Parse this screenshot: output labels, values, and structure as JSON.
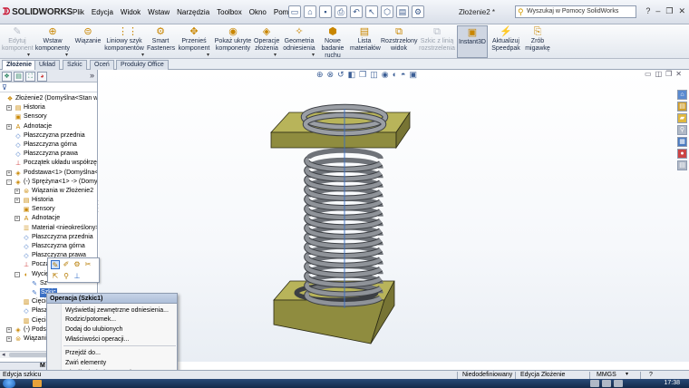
{
  "app": {
    "logo": "SOLIDWORKS",
    "document_title": "Złożenie2 *"
  },
  "menu": {
    "items": [
      "Plik",
      "Edycja",
      "Widok",
      "Wstaw",
      "Narzędzia",
      "Toolbox",
      "Okno",
      "Pomoc"
    ]
  },
  "help_search": {
    "placeholder": "Wyszukaj w Pomocy SolidWorks"
  },
  "command_manager": [
    {
      "label": "Edytuj\nkomponent",
      "icon": "edit-component-icon",
      "state": "disabled"
    },
    {
      "label": "Wstaw\nkomponenty",
      "icon": "insert-components-icon",
      "state": "normal"
    },
    {
      "label": "Wiązanie",
      "icon": "mate-icon",
      "state": "normal"
    },
    {
      "label": "Liniowy szyk\nkomponentów",
      "icon": "linear-pattern-icon",
      "state": "normal"
    },
    {
      "label": "Smart\nFasteners",
      "icon": "smart-fasteners-icon",
      "state": "normal"
    },
    {
      "label": "Przenieś\nkomponent",
      "icon": "move-component-icon",
      "state": "normal"
    },
    {
      "label": "Pokaż ukryte\nkomponenty",
      "icon": "show-hidden-icon",
      "state": "normal"
    },
    {
      "label": "Operacje\nzłożenia",
      "icon": "assembly-features-icon",
      "state": "normal"
    },
    {
      "label": "Geometria\nodniesienia",
      "icon": "reference-geometry-icon",
      "state": "normal"
    },
    {
      "label": "Nowe\nbadanie\nruchu",
      "icon": "motion-study-icon",
      "state": "normal"
    },
    {
      "label": "Lista\nmateriałów",
      "icon": "bom-icon",
      "state": "normal"
    },
    {
      "label": "Rozstrzelony\nwidok",
      "icon": "exploded-view-icon",
      "state": "normal"
    },
    {
      "label": "Szkic z linią\nrozstrzelenia",
      "icon": "explode-line-sketch-icon",
      "state": "disabled"
    },
    {
      "label": "Instant3D",
      "icon": "instant3d-icon",
      "state": "active"
    },
    {
      "label": "Aktualizuj\nSpeedpak",
      "icon": "speedpak-icon",
      "state": "normal"
    },
    {
      "label": "Zrób\nmigawkę",
      "icon": "snapshot-icon",
      "state": "normal"
    }
  ],
  "tabs": [
    "Złożenie",
    "Układ",
    "Szkic",
    "Oceń",
    "Produkty Office"
  ],
  "selected_tab": "Złożenie",
  "tree": [
    {
      "label": "Złożenie2 (Domyślna<Stan wyś",
      "indent": 0,
      "expander": "",
      "icon": "assembly-icon"
    },
    {
      "label": "Historia",
      "indent": 1,
      "expander": "+",
      "icon": "history-icon"
    },
    {
      "label": "Sensory",
      "indent": 1,
      "expander": "",
      "icon": "sensors-icon"
    },
    {
      "label": "Adnotacje",
      "indent": 1,
      "expander": "+",
      "icon": "annotations-icon"
    },
    {
      "label": "Płaszczyzna przednia",
      "indent": 1,
      "expander": "",
      "icon": "plane-icon"
    },
    {
      "label": "Płaszczyzna górna",
      "indent": 1,
      "expander": "",
      "icon": "plane-icon"
    },
    {
      "label": "Płaszczyzna prawa",
      "indent": 1,
      "expander": "",
      "icon": "plane-icon"
    },
    {
      "label": "Początek układu współrzędn",
      "indent": 1,
      "expander": "",
      "icon": "origin-icon"
    },
    {
      "label": "Podstawa<1> (Domyślna<<",
      "indent": 1,
      "expander": "+",
      "icon": "part-icon"
    },
    {
      "label": "(-) Sprężyna<1> -> (Domyśl",
      "indent": 1,
      "expander": "-",
      "icon": "part-icon"
    },
    {
      "label": "Wiązania w Złożenie2",
      "indent": 2,
      "expander": "+",
      "icon": "mates-icon"
    },
    {
      "label": "Historia",
      "indent": 2,
      "expander": "+",
      "icon": "history-icon"
    },
    {
      "label": "Sensory",
      "indent": 2,
      "expander": "",
      "icon": "sensors-icon"
    },
    {
      "label": "Adnotacje",
      "indent": 2,
      "expander": "+",
      "icon": "annotations-icon"
    },
    {
      "label": "Materiał <nieokreślony>",
      "indent": 2,
      "expander": "",
      "icon": "material-icon"
    },
    {
      "label": "Płaszczyzna przednia",
      "indent": 2,
      "expander": "",
      "icon": "plane-icon"
    },
    {
      "label": "Płaszczyzna górna",
      "indent": 2,
      "expander": "",
      "icon": "plane-icon"
    },
    {
      "label": "Płaszczyzna prawa",
      "indent": 2,
      "expander": "",
      "icon": "plane-icon"
    },
    {
      "label": "Począ",
      "indent": 2,
      "expander": "",
      "icon": "origin-icon"
    },
    {
      "label": "Wycię",
      "indent": 2,
      "expander": "-",
      "icon": "sweep-icon"
    },
    {
      "label": "Sz",
      "indent": 3,
      "expander": "",
      "icon": "sketch-icon"
    },
    {
      "label": "Szkic",
      "indent": 3,
      "expander": "",
      "icon": "sketch-icon",
      "highlight": true
    },
    {
      "label": "Cięcie",
      "indent": 2,
      "expander": "",
      "icon": "cut-icon"
    },
    {
      "label": "Płaszc",
      "indent": 2,
      "expander": "",
      "icon": "plane-icon"
    },
    {
      "label": "Cięcie",
      "indent": 2,
      "expander": "",
      "icon": "cut-icon"
    },
    {
      "label": "(-) Podstaw",
      "indent": 1,
      "expander": "+",
      "icon": "part-icon"
    },
    {
      "label": "Wiązania",
      "indent": 1,
      "expander": "+",
      "icon": "mates-icon"
    }
  ],
  "panel_bottom_tab": "M",
  "context_menu": {
    "title": "Operacja (Szkic1)",
    "items": [
      "Wyświetlaj zewnętrzne odniesienia...",
      "Rodzic/potomek...",
      "Dodaj do ulubionych",
      "Właściwości operacji...",
      "Przejdź do...",
      "Zwiń elementy",
      "Ukryj/pokaż elementy drzewa...",
      "Dostosuj menu"
    ]
  },
  "status": {
    "left": "Edycja szkicu",
    "definition": "Niedodefiniowany",
    "mode": "Edycja Złożenie",
    "units": "MMGS",
    "help": "?"
  },
  "taskbar": {
    "time": "17:38"
  },
  "colors": {
    "plate": "#b8b45a",
    "plate_side": "#8f8c3f",
    "coil": "#8f9399",
    "accent": "#3a6fc4"
  }
}
